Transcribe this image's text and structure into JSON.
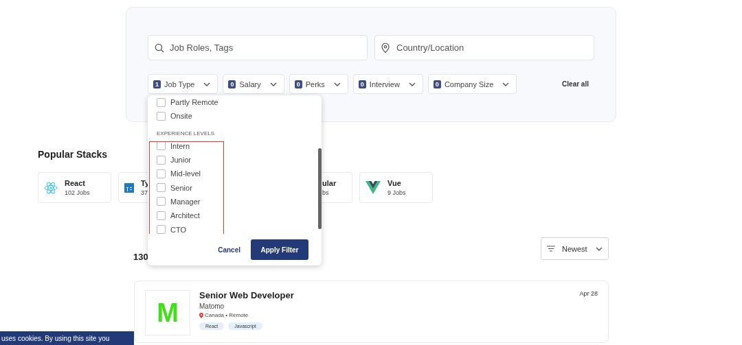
{
  "search": {
    "role_placeholder": "Job Roles, Tags",
    "location_placeholder": "Country/Location"
  },
  "filters": [
    {
      "count": "1",
      "label": "Job Type"
    },
    {
      "count": "0",
      "label": "Salary"
    },
    {
      "count": "0",
      "label": "Perks"
    },
    {
      "count": "0",
      "label": "Interview"
    },
    {
      "count": "0",
      "label": "Company Size"
    }
  ],
  "clear_all": "Clear all",
  "popular_stacks": {
    "title": "Popular Stacks",
    "items": [
      {
        "kind": "react",
        "name": "React",
        "jobs": "102 Jobs"
      },
      {
        "kind": "typescript",
        "name": "Ty",
        "jobs": "37"
      },
      {
        "kind": "covered",
        "name": "ular",
        "jobs": "bs"
      },
      {
        "kind": "vue",
        "name": "Vue",
        "jobs": "9 Jobs"
      }
    ]
  },
  "dropdown": {
    "options": [
      {
        "label": "Partly Remote",
        "checked": false
      },
      {
        "label": "Onsite",
        "checked": false
      }
    ],
    "section": "EXPERIENCE LEVELS",
    "levels": [
      {
        "label": "Intern",
        "checked": false
      },
      {
        "label": "Junior",
        "checked": false
      },
      {
        "label": "Mid-level",
        "checked": false
      },
      {
        "label": "Senior",
        "checked": false
      },
      {
        "label": "Manager",
        "checked": false
      },
      {
        "label": "Architect",
        "checked": false
      },
      {
        "label": "CTO",
        "checked": false
      }
    ],
    "cancel": "Cancel",
    "apply": "Apply Filter"
  },
  "results": {
    "count": "130",
    "sort": "Newest"
  },
  "job": {
    "logo_letter": "M",
    "title": "Senior Web Developer",
    "company": "Matomo",
    "location": "Canada • Remote",
    "date": "Apr 28",
    "tags": [
      "React",
      "Javascript"
    ]
  },
  "cookie_banner": "uses cookies. By using this site you"
}
